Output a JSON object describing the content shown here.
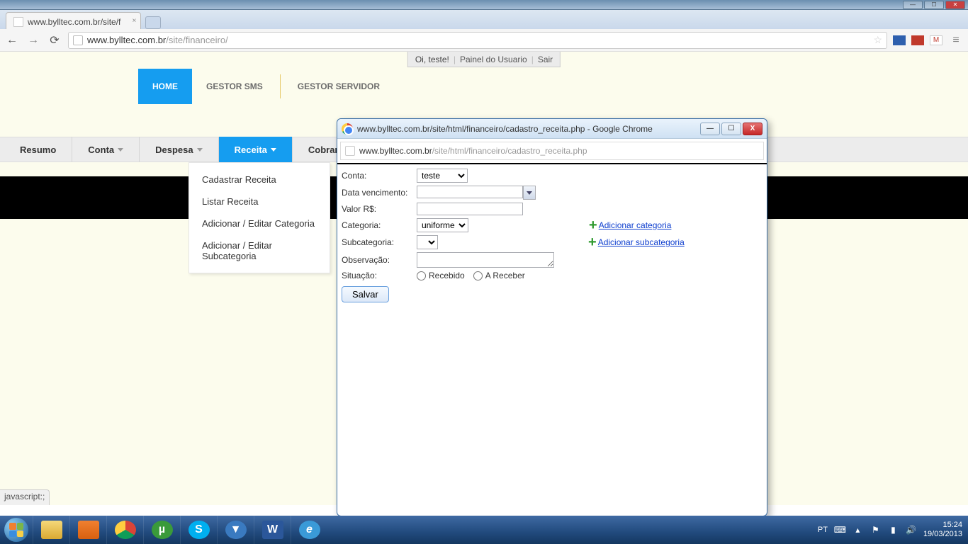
{
  "browser": {
    "tab_title": "www.bylltec.com.br/site/f",
    "url_host": "www.bylltec.com.br",
    "url_path": "/site/financeiro/",
    "status_text": "javascript:;"
  },
  "userbar": {
    "greeting": "Oi, teste!",
    "panel": "Painel do Usuario",
    "logout": "Sair"
  },
  "topnav": {
    "home": "HOME",
    "gestor_sms": "GESTOR SMS",
    "gestor_servidor": "GESTOR SERVIDOR"
  },
  "tabs": {
    "resumo": "Resumo",
    "conta": "Conta",
    "despesa": "Despesa",
    "receita": "Receita",
    "cobranca": "Cobrança"
  },
  "dropdown": {
    "cadastrar": "Cadastrar Receita",
    "listar": "Listar Receita",
    "editar_cat": "Adicionar / Editar Categoria",
    "editar_sub": "Adicionar / Editar Subcategoria"
  },
  "popup": {
    "title": "www.bylltec.com.br/site/html/financeiro/cadastro_receita.php - Google Chrome",
    "url_host": "www.bylltec.com.br",
    "url_path": "/site/html/financeiro/cadastro_receita.php",
    "labels": {
      "conta": "Conta:",
      "data": "Data vencimento:",
      "valor": "Valor R$:",
      "categoria": "Categoria:",
      "subcategoria": "Subcategoria:",
      "observacao": "Observação:",
      "situacao": "Situação:"
    },
    "conta_opt": "teste",
    "categoria_opt": "uniforme",
    "add_cat": "Adicionar categoria",
    "add_sub": "Adicionar subcategoria",
    "recebido": "Recebido",
    "areceber": "A Receber",
    "save": "Salvar"
  },
  "taskbar": {
    "lang": "PT",
    "time": "15:24",
    "date": "19/03/2013"
  }
}
